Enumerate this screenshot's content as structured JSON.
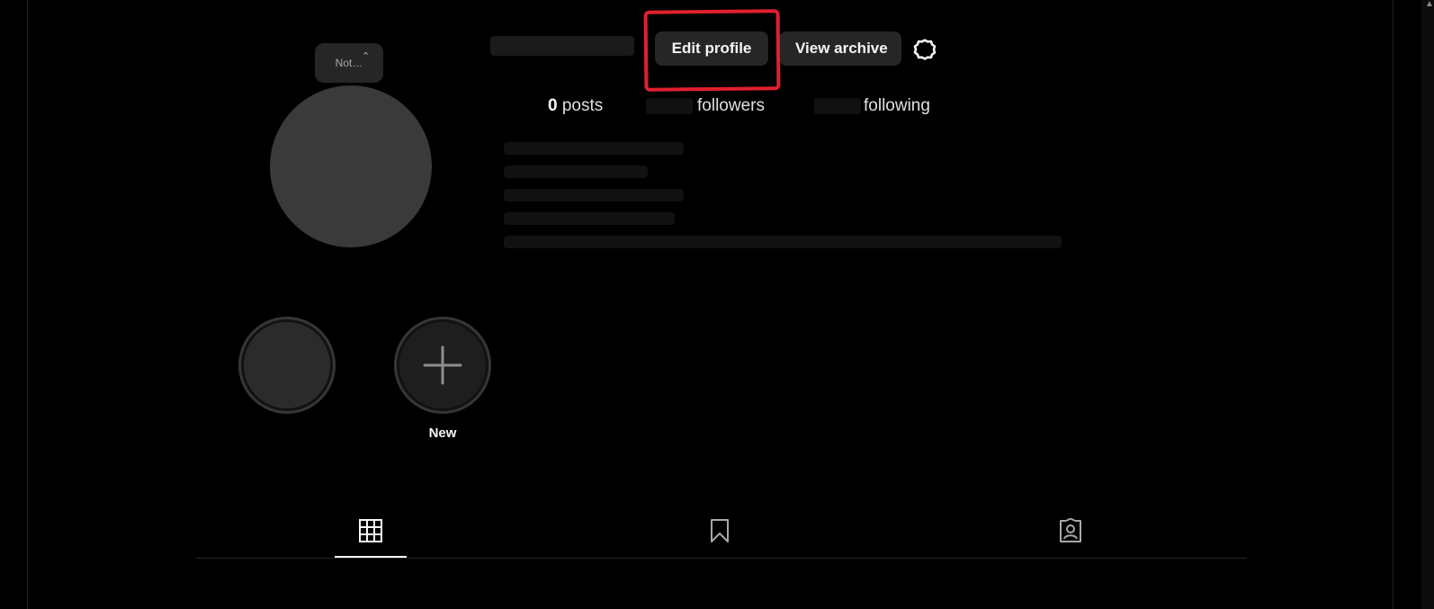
{
  "profile": {
    "note_text": "Not…",
    "edit_profile_label": "Edit profile",
    "view_archive_label": "View archive",
    "stats": {
      "posts_count": "0",
      "posts_label": "posts",
      "followers_label": "followers",
      "following_label": "following"
    }
  },
  "highlights": [
    {
      "label": "",
      "icon": "highlight-cover"
    },
    {
      "label": "New",
      "icon": "plus-icon"
    }
  ],
  "tabs": [
    {
      "name": "posts",
      "icon": "grid-icon",
      "active": true
    },
    {
      "name": "saved",
      "icon": "bookmark-icon",
      "active": false
    },
    {
      "name": "tagged",
      "icon": "tagged-user-icon",
      "active": false
    }
  ],
  "colors": {
    "background": "#000000",
    "button": "#262626",
    "highlight_box": "#e0202f"
  }
}
